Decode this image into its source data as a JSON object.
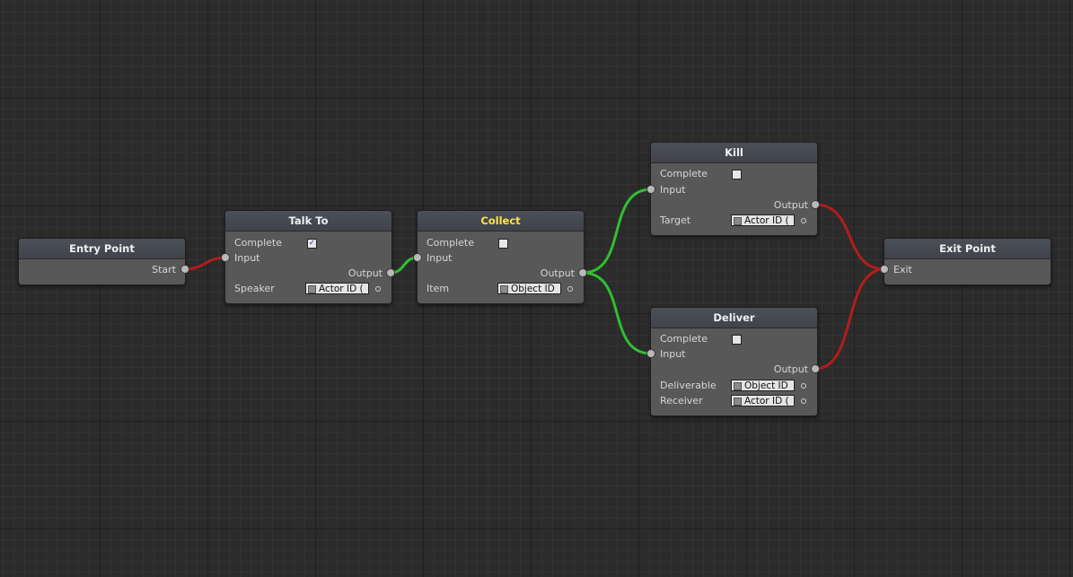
{
  "colors": {
    "wire_complete": "#2fbf2f",
    "wire_incomplete": "#b21c1c",
    "active_title": "#ffe34a"
  },
  "nodes": {
    "entry": {
      "title": "Entry Point",
      "start_label": "Start"
    },
    "talk_to": {
      "title": "Talk To",
      "complete_label": "Complete",
      "complete_checked": true,
      "input_label": "Input",
      "output_label": "Output",
      "speaker_label": "Speaker",
      "speaker_value": "Actor ID ("
    },
    "collect": {
      "title": "Collect",
      "complete_label": "Complete",
      "complete_checked": false,
      "input_label": "Input",
      "output_label": "Output",
      "item_label": "Item",
      "item_value": "Object ID"
    },
    "kill": {
      "title": "Kill",
      "complete_label": "Complete",
      "complete_checked": false,
      "input_label": "Input",
      "output_label": "Output",
      "target_label": "Target",
      "target_value": "Actor ID ("
    },
    "deliver": {
      "title": "Deliver",
      "complete_label": "Complete",
      "complete_checked": false,
      "input_label": "Input",
      "output_label": "Output",
      "deliverable_label": "Deliverable",
      "deliverable_value": "Object ID",
      "receiver_label": "Receiver",
      "receiver_value": "Actor ID ("
    },
    "exit": {
      "title": "Exit Point",
      "exit_label": "Exit"
    }
  }
}
